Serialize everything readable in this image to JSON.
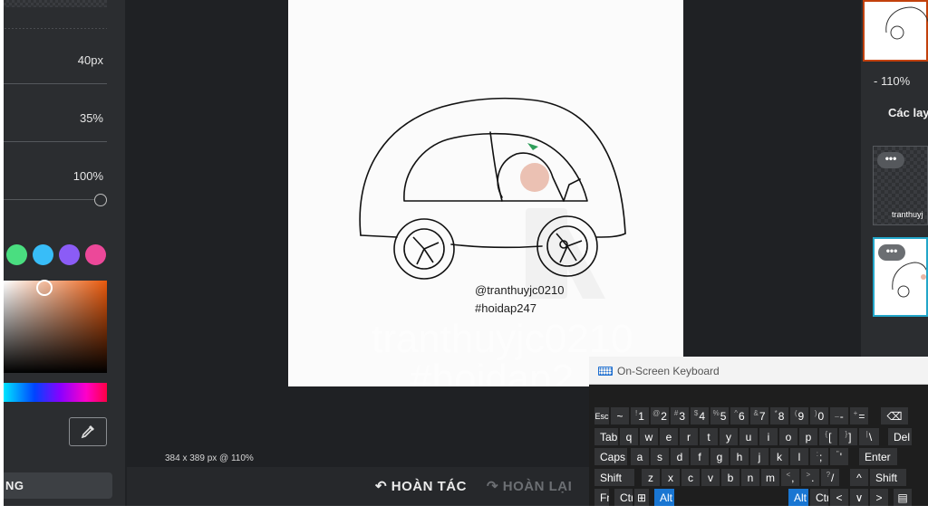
{
  "left_panel": {
    "size_value": "40px",
    "opacity_value": "35%",
    "hardness_value": "100%",
    "swatches": [
      "#4ade80",
      "#38bdf8",
      "#8b5cf6",
      "#ec4899"
    ],
    "save_label": "NG"
  },
  "canvas": {
    "caption_line1": "@tranthuyjc0210",
    "caption_line2": "#hoidap247",
    "watermark_line1": "tranthuyjc0210",
    "watermark_line2": "#hoidap2"
  },
  "status": {
    "dimensions": "384 x 389 px @ 110%"
  },
  "toolbar": {
    "undo_label": "HOÀN TÁC",
    "redo_label": "HOÀN LẠI"
  },
  "right_panel": {
    "zoom_label": "- 110%",
    "layers_title": "Các layer",
    "layer1_name": "tranthuyj"
  },
  "keyboard": {
    "title": "On-Screen Keyboard",
    "rows": [
      [
        {
          "k": "Esc"
        },
        {
          "k": "~"
        },
        {
          "k": "1",
          "s": "!"
        },
        {
          "k": "2",
          "s": "@"
        },
        {
          "k": "3",
          "s": "#"
        },
        {
          "k": "4",
          "s": "$"
        },
        {
          "k": "5",
          "s": "%"
        },
        {
          "k": "6",
          "s": "^"
        },
        {
          "k": "7",
          "s": "&"
        },
        {
          "k": "8",
          "s": "*"
        },
        {
          "k": "9",
          "s": "("
        },
        {
          "k": "0",
          "s": ")"
        },
        {
          "k": "-",
          "s": "_"
        },
        {
          "k": "=",
          "s": "+"
        },
        {
          "k": "⌫"
        }
      ],
      [
        {
          "k": "Tab"
        },
        {
          "k": "q"
        },
        {
          "k": "w"
        },
        {
          "k": "e"
        },
        {
          "k": "r"
        },
        {
          "k": "t"
        },
        {
          "k": "y"
        },
        {
          "k": "u"
        },
        {
          "k": "i"
        },
        {
          "k": "o"
        },
        {
          "k": "p"
        },
        {
          "k": "[",
          "s": "{"
        },
        {
          "k": "]",
          "s": "}"
        },
        {
          "k": "\\",
          "s": "|"
        },
        {
          "k": "Del"
        }
      ],
      [
        {
          "k": "Caps"
        },
        {
          "k": "a"
        },
        {
          "k": "s"
        },
        {
          "k": "d"
        },
        {
          "k": "f"
        },
        {
          "k": "g"
        },
        {
          "k": "h"
        },
        {
          "k": "j"
        },
        {
          "k": "k"
        },
        {
          "k": "l"
        },
        {
          "k": ";",
          "s": ":"
        },
        {
          "k": "'",
          "s": "\""
        },
        {
          "k": "Enter"
        }
      ],
      [
        {
          "k": "Shift"
        },
        {
          "k": "z"
        },
        {
          "k": "x"
        },
        {
          "k": "c"
        },
        {
          "k": "v"
        },
        {
          "k": "b"
        },
        {
          "k": "n"
        },
        {
          "k": "m"
        },
        {
          "k": ",",
          "s": "<"
        },
        {
          "k": ".",
          "s": ">"
        },
        {
          "k": "/",
          "s": "?"
        },
        {
          "k": "^"
        },
        {
          "k": "Shift"
        }
      ],
      [
        {
          "k": "Fn"
        },
        {
          "k": "Ctrl"
        },
        {
          "k": "⊞"
        },
        {
          "k": "Alt",
          "active": true
        },
        {
          "k": "Alt",
          "active": true
        },
        {
          "k": "Ctrl"
        },
        {
          "k": "<"
        },
        {
          "k": "∨"
        },
        {
          "k": ">"
        },
        {
          "k": "▤"
        }
      ]
    ]
  }
}
